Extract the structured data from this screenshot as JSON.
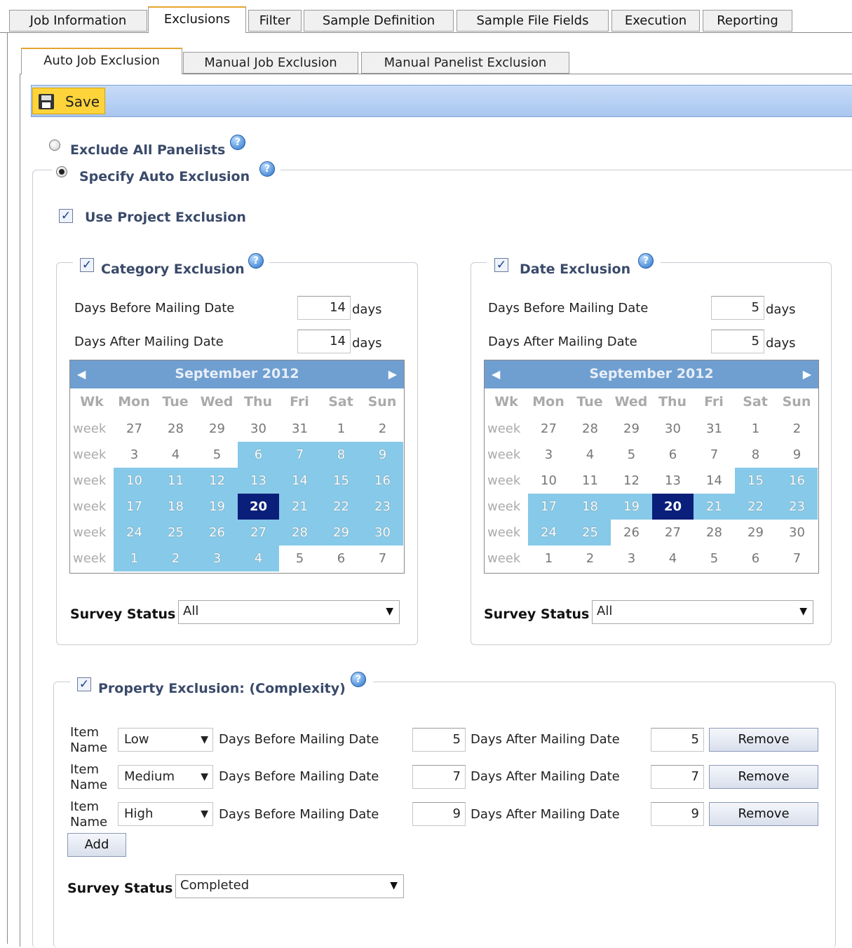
{
  "top_tabs": [
    "Job Information",
    "Exclusions",
    "Filter",
    "Sample Definition",
    "Sample File Fields",
    "Execution",
    "Reporting"
  ],
  "sub_tabs": [
    "Auto Job Exclusion",
    "Manual Job Exclusion",
    "Manual Panelist Exclusion"
  ],
  "toolbar": {
    "save_label": "Save"
  },
  "options": {
    "exclude_all": "Exclude All Panelists",
    "specify_auto": "Specify Auto Exclusion",
    "use_project": "Use Project Exclusion"
  },
  "category": {
    "title": "Category Exclusion",
    "before_label": "Days Before Mailing Date",
    "after_label": "Days After Mailing Date",
    "before_value": "14",
    "after_value": "14",
    "days": "days",
    "status_label": "Survey Status",
    "status_value": "All"
  },
  "date": {
    "title": "Date Exclusion",
    "before_label": "Days Before Mailing Date",
    "after_label": "Days After Mailing Date",
    "before_value": "5",
    "after_value": "5",
    "days": "days",
    "status_label": "Survey Status",
    "status_value": "All"
  },
  "calendar": {
    "month": "September 2012",
    "prev": "◀",
    "next": "▶",
    "dow": [
      "Wk",
      "Mon",
      "Tue",
      "Wed",
      "Thu",
      "Fri",
      "Sat",
      "Sun"
    ],
    "week_label": "week",
    "weeks": [
      [
        "27",
        "28",
        "29",
        "30",
        "31",
        "1",
        "2"
      ],
      [
        "3",
        "4",
        "5",
        "6",
        "7",
        "8",
        "9"
      ],
      [
        "10",
        "11",
        "12",
        "13",
        "14",
        "15",
        "16"
      ],
      [
        "17",
        "18",
        "19",
        "20",
        "21",
        "22",
        "23"
      ],
      [
        "24",
        "25",
        "26",
        "27",
        "28",
        "29",
        "30"
      ],
      [
        "1",
        "2",
        "3",
        "4",
        "5",
        "6",
        "7"
      ]
    ],
    "selected": "20"
  },
  "property": {
    "title": "Property Exclusion: (Complexity)",
    "item_label_1": "Item",
    "item_label_2": "Name",
    "before_label": "Days Before Mailing Date",
    "after_label": "Days After Mailing Date",
    "remove_label": "Remove",
    "add_label": "Add",
    "rows": [
      {
        "name": "Low",
        "before": "5",
        "after": "5"
      },
      {
        "name": "Medium",
        "before": "7",
        "after": "7"
      },
      {
        "name": "High",
        "before": "9",
        "after": "9"
      }
    ],
    "status_label": "Survey Status",
    "status_value": "Completed"
  },
  "icons": {
    "help": "?",
    "check": "✓",
    "dropdown": "▼"
  }
}
